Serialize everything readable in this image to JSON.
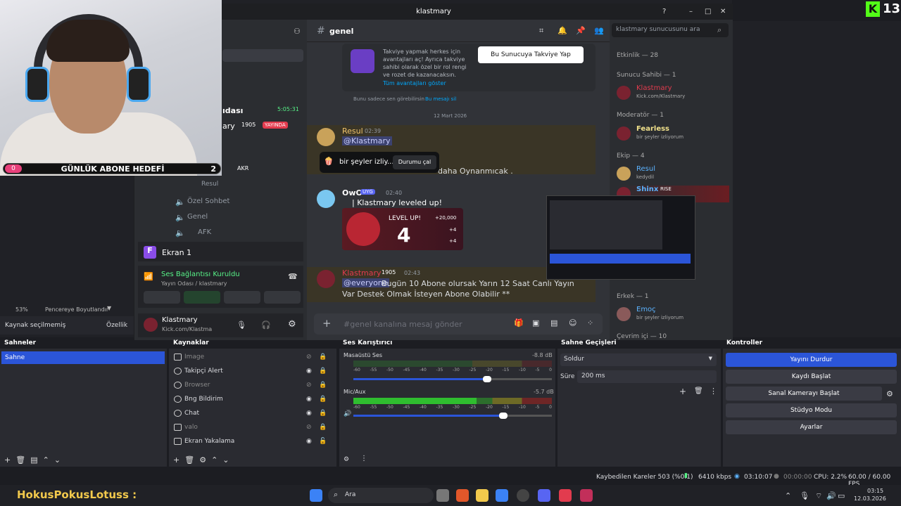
{
  "topright": {
    "brand": "K",
    "count": "13"
  },
  "webcam": {
    "goal_count": "0",
    "goal_label": "GÜNLÜK ABONE HEDEFİ",
    "goal_target": "2"
  },
  "discord": {
    "window_title": "klastmary",
    "channel": "genel",
    "search_placeholder": "klastmary sunucusunu ara",
    "sidebar": {
      "time": "5:05:31",
      "category": "Özel Sohbet",
      "voice1": "Genel",
      "voice2": "AFK",
      "user_partial": "Resul",
      "live_label": "YAYINDA",
      "badge": "1905",
      "akr": "AKR",
      "title_partial": "ıdası",
      "ary": "ary"
    },
    "boost": {
      "text_line": "Takviye yapmak herkes için avantajları aç! Ayrıca takviye sahibi olarak özel bir rol rengi ve rozet de kazanacaksın.",
      "link": "Tüm avantajları göster",
      "button": "Bu Sunucuya Takviye Yap",
      "footer": "Bunu sadece sen görebilirsin",
      "footer_link": "Bu mesajı sil"
    },
    "date_divider": "12 Mart 2026",
    "messages": [
      {
        "author": "Resul",
        "time": "02:39",
        "mention": "@Klastmary",
        "tail": "daha Oynanmıcak ."
      },
      {
        "author": "OwO",
        "tag": "UYG",
        "time": "02:40",
        "text": "| Klastmary leveled up!"
      },
      {
        "author": "Klastmary",
        "badge": "1905",
        "time": "02:43",
        "mention": "@everyone",
        "text": "Bugün 10 Abone olursak Yarın 12 Saat Canlı Yayın Var Destek Olmak İsteyen Abone Olabilir **"
      }
    ],
    "levelup": {
      "label": "LEVEL UP!",
      "level": "4",
      "xp": "+20,000",
      "r1": "+4",
      "r2": "+4"
    },
    "popup": {
      "text": "bir şeyler izliy...",
      "button": "Durumu çal"
    },
    "composer_placeholder": "#genel kanalına mesaj gönder",
    "screen_card": "Ekran 1",
    "voice_status": "Ses Bağlantısı Kuruldu",
    "voice_sub": "Yayın Odası / klastmary",
    "me_name": "Klastmary",
    "me_sub": "Kick.com/Klastma",
    "members": {
      "activity": "Etkinlik — 28",
      "owner_hdr": "Sunucu Sahibi — 1",
      "owner": "Klastmary",
      "owner_badge": "1905",
      "owner_sub": "Kick.com/Klastmary",
      "mod_hdr": "Moderatör — 1",
      "mod": "Fearless",
      "mod_sub": "bir şeyler izliyorum",
      "team_hdr": "Ekip — 4",
      "team1": "Resul",
      "team1_sub": "kedydil",
      "team2": "Shinx",
      "team2_badge": "RISE",
      "male_hdr": "Erkek — 1",
      "male1": "Emoç",
      "male1_sub": "bir şeyler izliyorum",
      "online_hdr": "Çevrim içi — 10"
    }
  },
  "obs": {
    "zoom": "53%",
    "fit": "Pencereye Boyutlandır",
    "no_source": "Kaynak seçilmemiş",
    "filters": "Özellik",
    "docks": {
      "scenes": "Sahneler",
      "sources": "Kaynaklar",
      "mixer": "Ses Karıştırıcı",
      "transitions": "Sahne Geçişleri",
      "controls": "Kontroller"
    },
    "scenes": [
      "Sahne"
    ],
    "sources": [
      "Image",
      "Takipçi Alert",
      "Browser",
      "Bng Bildirim",
      "Chat",
      "valo",
      "Ekran Yakalama"
    ],
    "mixer": [
      {
        "name": "Masaüstü Ses",
        "db": "-8.8 dB",
        "level": 0.82
      },
      {
        "name": "Mic/Aux",
        "db": "-5.7 dB",
        "level": 0.8
      }
    ],
    "ticks": [
      "-60",
      "-55",
      "-50",
      "-45",
      "-40",
      "-35",
      "-30",
      "-25",
      "-20",
      "-15",
      "-10",
      "-5",
      "0"
    ],
    "transition": "Soldur",
    "duration_label": "Süre",
    "duration": "200 ms",
    "controls": [
      "Yayını Durdur",
      "Kaydı Başlat",
      "Sanal Kamerayı Başlat",
      "Stüdyo Modu",
      "Ayarlar"
    ],
    "status": {
      "dropped": "Kaybedilen Kareler 503 (%0.1)",
      "kbps": "6410 kbps",
      "stream": "03:10:07",
      "rec": "00:00:00",
      "cpu": "CPU: 2.2%",
      "fps": "60.00 / 60.00 FPS"
    }
  },
  "ticker": "HokusPokusLotuss :",
  "taskbar": {
    "search": "Ara",
    "time": "03:15",
    "date": "12.03.2026"
  },
  "colors": {
    "accent": "#2b55d8",
    "live": "#e23b4e",
    "green": "#57f287",
    "kick": "#53fc18"
  }
}
